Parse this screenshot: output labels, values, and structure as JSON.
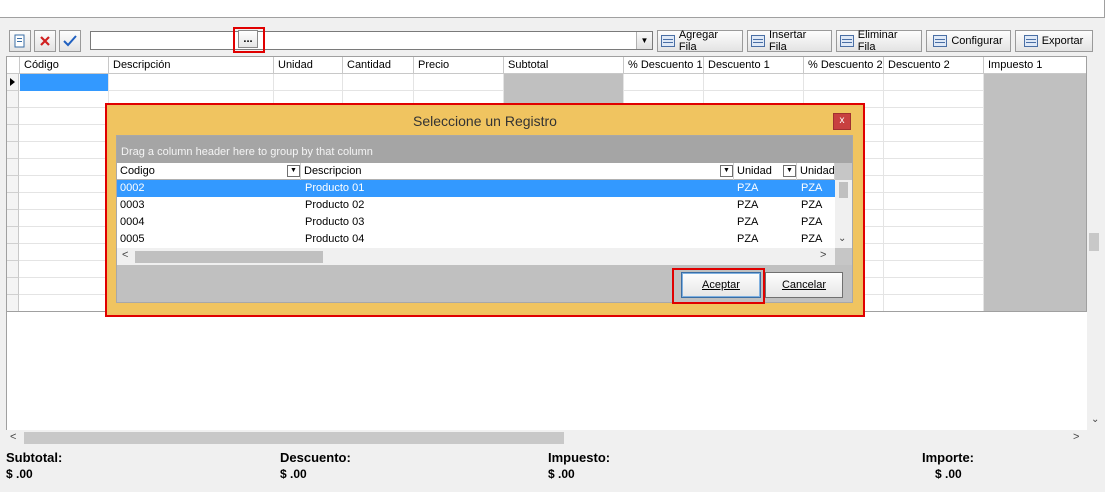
{
  "toolbar": {
    "ellipsis_label": "...",
    "buttons": [
      {
        "label": "Agregar Fila",
        "icon": "add-row-icon"
      },
      {
        "label": "Insertar Fila",
        "icon": "insert-row-icon"
      },
      {
        "label": "Eliminar Fila",
        "icon": "delete-row-icon"
      },
      {
        "label": "Configurar",
        "icon": "configure-icon"
      },
      {
        "label": "Exportar",
        "icon": "export-icon"
      }
    ],
    "combo_arrow": "▼"
  },
  "grid": {
    "columns": [
      "Código",
      "Descripción",
      "Unidad",
      "Cantidad",
      "Precio",
      "Subtotal",
      "% Descuento 1",
      "Descuento 1",
      "% Descuento 2",
      "Descuento 2",
      "Impuesto 1"
    ]
  },
  "dialog": {
    "title": "Seleccione un Registro",
    "close_label": "x",
    "group_hint": "Drag a column header here to group by that column",
    "columns": [
      "Codigo",
      "Descripcion",
      "Unidad",
      "Unidad"
    ],
    "rows": [
      {
        "codigo": "0002",
        "descripcion": "Producto 01",
        "unidad": "PZA",
        "unidad2": "PZA"
      },
      {
        "codigo": "0003",
        "descripcion": "Producto 02",
        "unidad": "PZA",
        "unidad2": "PZA"
      },
      {
        "codigo": "0004",
        "descripcion": "Producto 03",
        "unidad": "PZA",
        "unidad2": "PZA"
      },
      {
        "codigo": "0005",
        "descripcion": "Producto 04",
        "unidad": "PZA",
        "unidad2": "PZA"
      }
    ],
    "accept_label": "Aceptar",
    "cancel_label": "Cancelar"
  },
  "totals": {
    "subtotal_label": "Subtotal:",
    "subtotal_value": "$ .00",
    "descuento_label": "Descuento:",
    "descuento_value": "$ .00",
    "impuesto_label": "Impuesto:",
    "impuesto_value": "$ .00",
    "importe_label": "Importe:",
    "importe_value": "$ .00"
  },
  "colors": {
    "selection": "#3399ff",
    "dialog_bg": "#f0c460",
    "highlight": "#e00000"
  }
}
